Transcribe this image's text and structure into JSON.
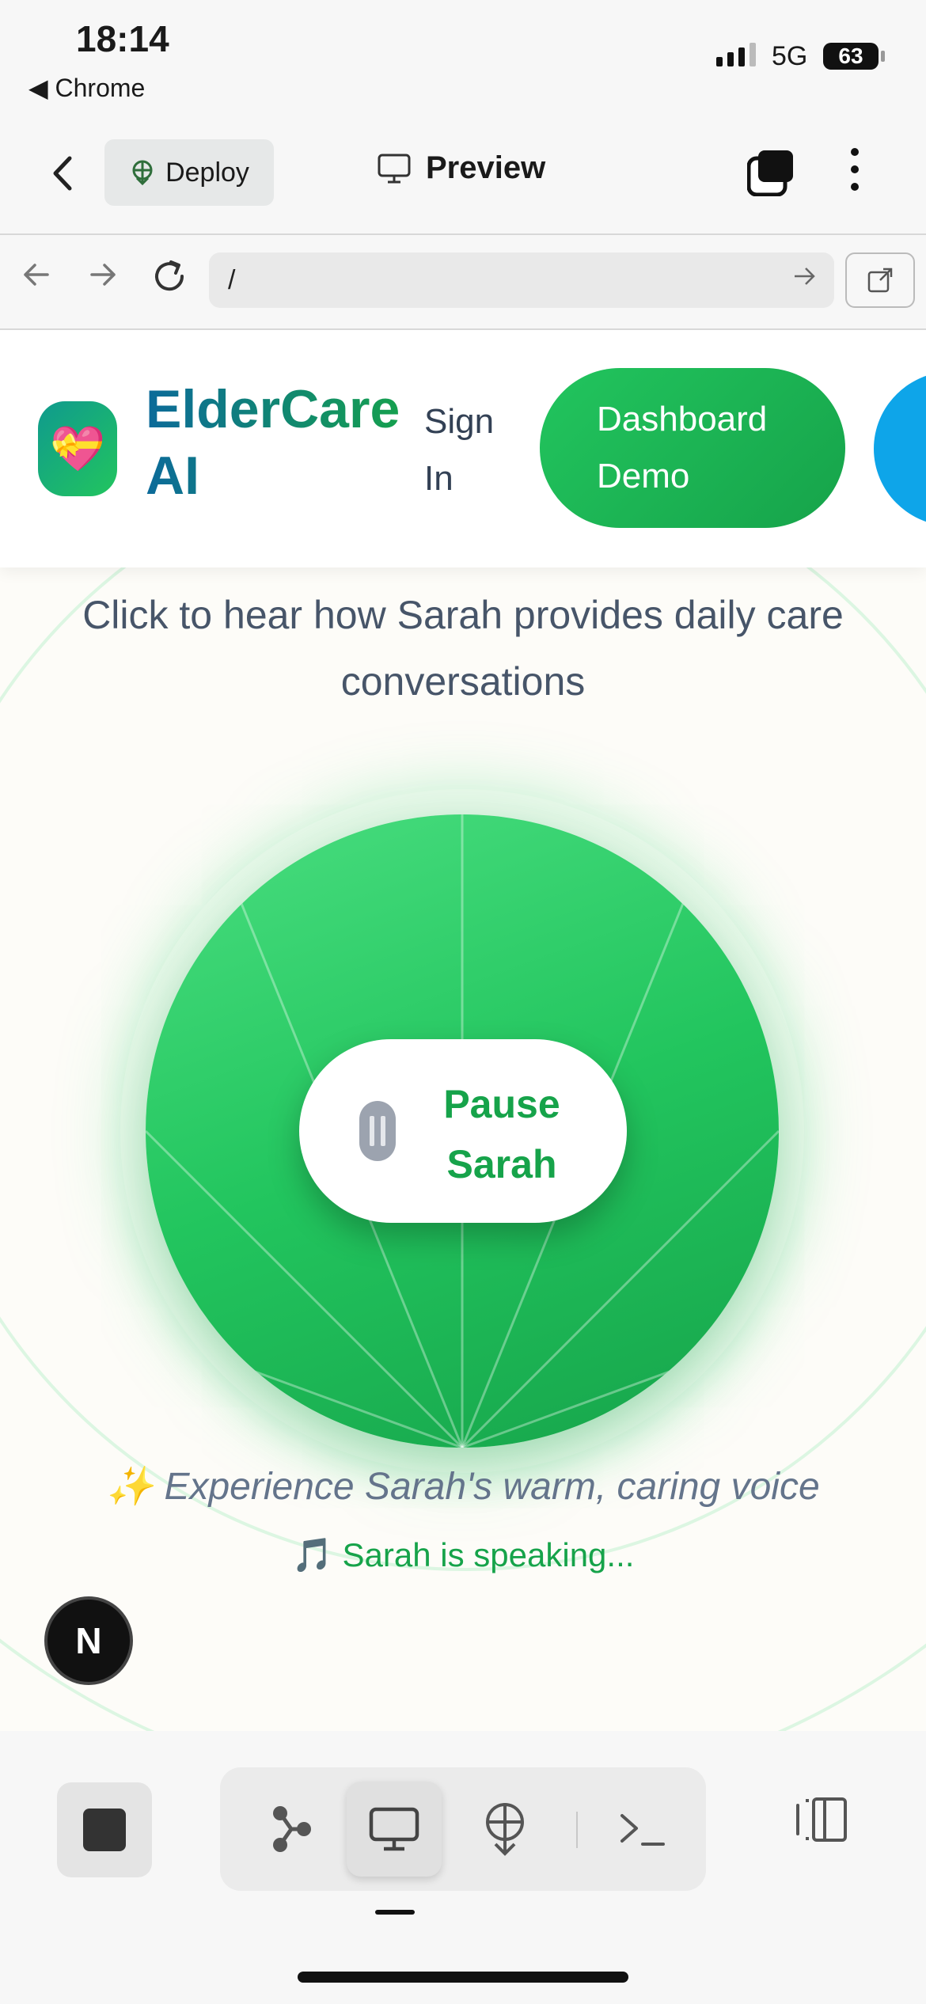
{
  "status_bar": {
    "time": "18:14",
    "back_app": "◀ Chrome",
    "network": "5G",
    "battery": "63"
  },
  "toolbar": {
    "deploy_label": "Deploy",
    "preview_label": "Preview",
    "icons": [
      "chevron-left-icon",
      "deploy-icon",
      "monitor-icon",
      "tabs-icon",
      "more-vertical-icon"
    ]
  },
  "url_bar": {
    "value": "/",
    "icons": [
      "back-arrow-icon",
      "forward-arrow-icon",
      "reload-icon",
      "go-arrow-icon",
      "open-external-icon"
    ]
  },
  "site": {
    "logo_emoji": "💝",
    "brand": "ElderCare AI",
    "sign_in": "Sign In",
    "dashboard_button": "Dashboard Demo",
    "subtitle": "Click to hear how Sarah provides daily care conversations",
    "pause_button": "Pause Sarah",
    "tagline": "✨ Experience Sarah's warm, caring voice",
    "speaking_status": "🎵 Sarah is speaking...",
    "framework_badge": "N"
  },
  "bottom_bar": {
    "icons": [
      "stop-icon",
      "graph-icon",
      "monitor-icon",
      "deploy-icon",
      "terminal-icon",
      "panel-icon"
    ],
    "active": "monitor-icon"
  },
  "colors": {
    "accent_green": "#22c55e",
    "brand_blue": "#0c6a9a",
    "text_slate": "#475569"
  }
}
